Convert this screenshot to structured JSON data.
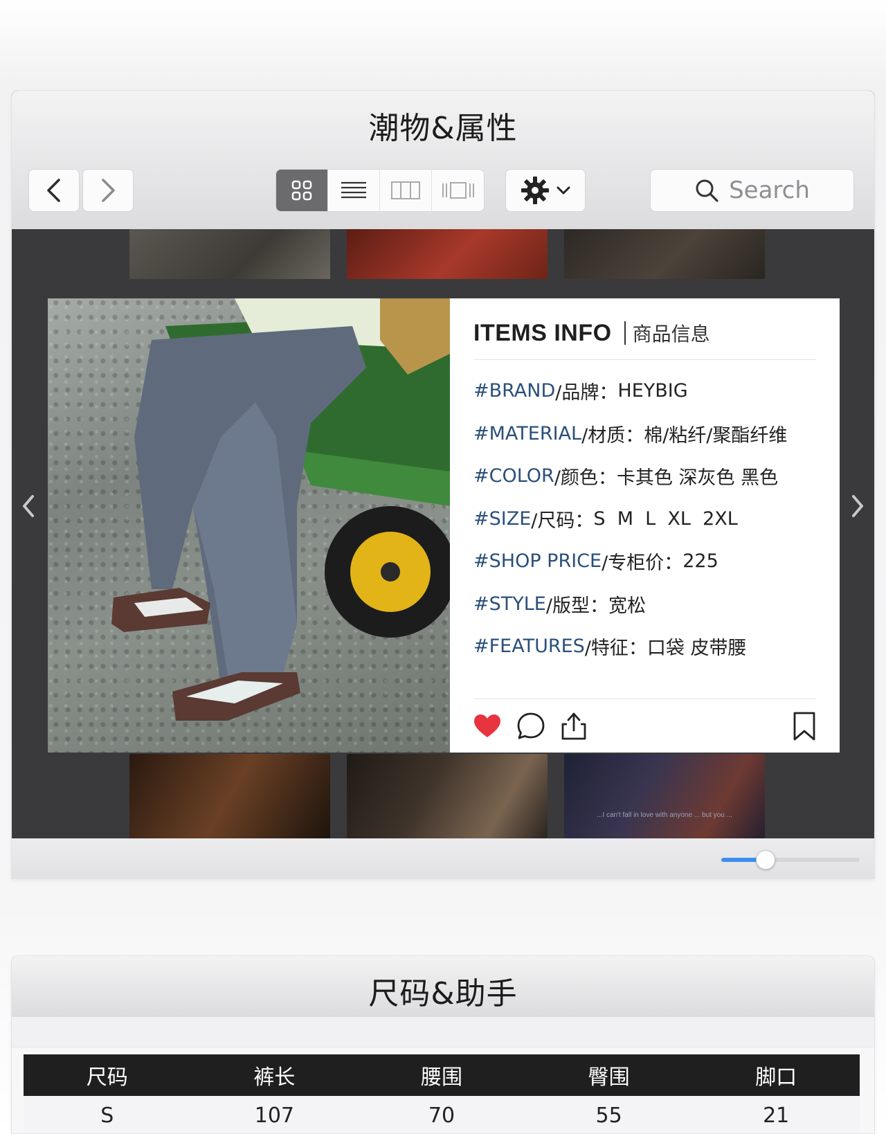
{
  "gallery_window": {
    "title": "潮物&属性",
    "search_placeholder": "Search",
    "view_modes": [
      "grid-icon",
      "list-icon",
      "columns-icon",
      "coverflow-icon"
    ],
    "active_view": "grid-icon",
    "thumb_caption": "...I can't fall in love with anyone ... but you ...",
    "zoom_level": 0.32,
    "accent_color": "#3b8ff0"
  },
  "card": {
    "title_en": "ITEMS INFO",
    "title_cn": "商品信息",
    "rows": [
      {
        "key": "#BRAND",
        "label": "/品牌：",
        "value": "HEYBIG"
      },
      {
        "key": "#MATERIAL",
        "label": "/材质：",
        "value": "棉/粘纤/聚酯纤维"
      },
      {
        "key": "#COLOR",
        "label": "/颜色：",
        "value": "卡其色 深灰色 黑色"
      },
      {
        "key": "#SIZE",
        "label": "/尺码：",
        "value": "S  M  L  XL  2XL"
      },
      {
        "key": "#SHOP PRICE",
        "label": "/专柜价：",
        "value": "225"
      },
      {
        "key": "#STYLE",
        "label": "/版型：",
        "value": "宽松"
      },
      {
        "key": "#FEATURES",
        "label": "/特征：",
        "value": "口袋 皮带腰"
      }
    ],
    "heart_color": "#e8343f"
  },
  "size_window": {
    "title": "尺码&助手",
    "headers": [
      "尺码",
      "裤长",
      "腰围",
      "臀围",
      "脚口"
    ],
    "rows": [
      [
        "S",
        "107",
        "70",
        "55",
        "21"
      ]
    ]
  }
}
